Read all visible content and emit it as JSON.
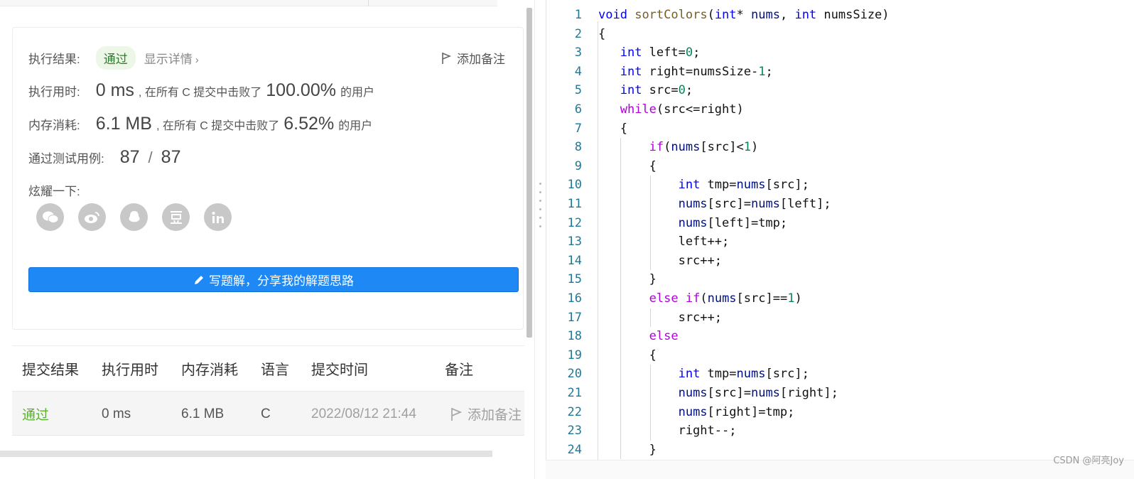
{
  "result": {
    "exec_label": "执行结果:",
    "status": "通过",
    "detail_link": "显示详情",
    "add_note": "添加备注",
    "time_label": "执行用时:",
    "time_value": "0 ms",
    "time_mid": ", 在所有 C 提交中击败了",
    "time_percent": "100.00%",
    "time_tail": "的用户",
    "mem_label": "内存消耗:",
    "mem_value": "6.1 MB",
    "mem_mid": ", 在所有 C 提交中击败了",
    "mem_percent": "6.52%",
    "mem_tail": "的用户",
    "tests_label": "通过测试用例:",
    "tests_passed": "87",
    "tests_sep": "/",
    "tests_total": "87",
    "share_label": "炫耀一下:",
    "share_icons": [
      "wechat-icon",
      "weibo-icon",
      "qq-icon",
      "douban-icon",
      "linkedin-icon"
    ],
    "write_solution": "写题解，分享我的解题思路"
  },
  "submissions": {
    "headers": [
      "提交结果",
      "执行用时",
      "内存消耗",
      "语言",
      "提交时间",
      "备注"
    ],
    "rows": [
      {
        "result": "通过",
        "time": "0 ms",
        "memory": "6.1 MB",
        "lang": "C",
        "submitted": "2022/08/12 21:44",
        "note": "添加备注"
      }
    ]
  },
  "editor": {
    "line_numbers": [
      "1",
      "2",
      "3",
      "4",
      "5",
      "6",
      "7",
      "8",
      "9",
      "10",
      "11",
      "12",
      "13",
      "14",
      "15",
      "16",
      "17",
      "18",
      "19",
      "20",
      "21",
      "22",
      "23",
      "24"
    ],
    "lines": [
      "void sortColors(int* nums, int numsSize)",
      "{",
      "   int left=0;",
      "   int right=numsSize-1;",
      "   int src=0;",
      "   while(src<=right)",
      "   {",
      "       if(nums[src]<1)",
      "       {",
      "           int tmp=nums[src];",
      "           nums[src]=nums[left];",
      "           nums[left]=tmp;",
      "           left++;",
      "           src++;",
      "       }",
      "       else if(nums[src]==1)",
      "           src++;",
      "       else",
      "       {",
      "           int tmp=nums[src];",
      "           nums[src]=nums[right];",
      "           nums[right]=tmp;",
      "           right--;",
      "       }"
    ]
  },
  "watermark": "CSDN @阿亮Joy",
  "colors": {
    "accent": "#1e88f5",
    "pass": "#5ab02f",
    "keyword": "#0000ff",
    "control": "#af00db",
    "function": "#795e26",
    "number": "#098658",
    "line_number": "#237893"
  }
}
